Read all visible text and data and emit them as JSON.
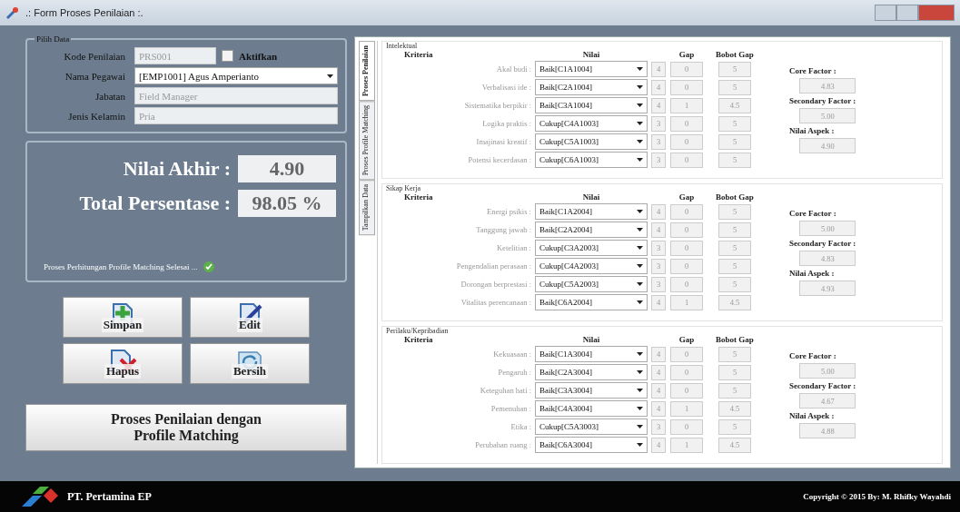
{
  "window": {
    "title": ".: Form Proses Penilaian :."
  },
  "pilih_data": {
    "legend": "Pilih Data",
    "kode_label": "Kode Penilaian",
    "kode_value": "PRS001",
    "aktifkan": {
      "label": "Aktifkan",
      "checked": false
    },
    "nama_label": "Nama Pegawai",
    "nama_value": "[EMP1001] Agus Amperianto",
    "jabatan_label": "Jabatan",
    "jabatan_value": "Field Manager",
    "jk_label": "Jenis Kelamin",
    "jk_value": "Pria"
  },
  "hasil": {
    "nilai_label": "Nilai Akhir :",
    "nilai_value": "4.90",
    "persen_label": "Total Persentase :",
    "persen_value": "98.05 %",
    "status": "Proses Perhitungan Profile Matching Selesai ..."
  },
  "buttons": [
    {
      "kind": "save",
      "label": "Simpan"
    },
    {
      "kind": "edit",
      "label": "Edit"
    },
    {
      "kind": "delete",
      "label": "Hapus"
    },
    {
      "kind": "clear",
      "label": "Bersih"
    }
  ],
  "proses_button": "Proses Penilaian dengan Profile Matching",
  "tabs": [
    {
      "label": "Proses Penilaian",
      "selected": true
    },
    {
      "label": "Proses Profile Matching",
      "selected": false
    },
    {
      "label": "Tampilkan Data",
      "selected": false
    }
  ],
  "aspects": [
    {
      "title": "Intelektual",
      "columns": {
        "kriteria": "Kriteria",
        "nilai": "Nilai",
        "gap": "Gap",
        "bobot": "Bobot Gap"
      },
      "core_label": "Core Factor :",
      "core": "4.83",
      "secondary_label": "Secondary Factor :",
      "secondary": "5.00",
      "aspek_label": "Nilai Aspek :",
      "aspek": "4.90",
      "rows": [
        {
          "label": "Akal budi :",
          "value": "Baik[C1A1004]",
          "nilai": "4",
          "gap": "0",
          "bobot": "5"
        },
        {
          "label": "Verbalisasi ide :",
          "value": "Baik[C2A1004]",
          "nilai": "4",
          "gap": "0",
          "bobot": "5"
        },
        {
          "label": "Sistematika berpikir :",
          "value": "Baik[C3A1004]",
          "nilai": "4",
          "gap": "1",
          "bobot": "4.5"
        },
        {
          "label": "Logika praktis :",
          "value": "Cukup[C4A1003]",
          "nilai": "3",
          "gap": "0",
          "bobot": "5"
        },
        {
          "label": "Imajinasi kreatif :",
          "value": "Cukup[C5A1003]",
          "nilai": "3",
          "gap": "0",
          "bobot": "5"
        },
        {
          "label": "Potensi kecerdasan :",
          "value": "Cukup[C6A1003]",
          "nilai": "3",
          "gap": "0",
          "bobot": "5"
        }
      ]
    },
    {
      "title": "Sikap Kerja",
      "columns": {
        "kriteria": "Kriteria",
        "nilai": "Nilai",
        "gap": "Gap",
        "bobot": "Bobot Gap"
      },
      "core_label": "Core Factor :",
      "core": "5.00",
      "secondary_label": "Secondary Factor :",
      "secondary": "4.83",
      "aspek_label": "Nilai Aspek :",
      "aspek": "4.93",
      "rows": [
        {
          "label": "Energi psikis :",
          "value": "Baik[C1A2004]",
          "nilai": "4",
          "gap": "0",
          "bobot": "5"
        },
        {
          "label": "Tanggung jawab :",
          "value": "Baik[C2A2004]",
          "nilai": "4",
          "gap": "0",
          "bobot": "5"
        },
        {
          "label": "Ketelitian :",
          "value": "Cukup[C3A2003]",
          "nilai": "3",
          "gap": "0",
          "bobot": "5"
        },
        {
          "label": "Pengendalian perasaan :",
          "value": "Cukup[C4A2003]",
          "nilai": "3",
          "gap": "0",
          "bobot": "5"
        },
        {
          "label": "Dorongan berprestasi :",
          "value": "Cukup[C5A2003]",
          "nilai": "3",
          "gap": "0",
          "bobot": "5"
        },
        {
          "label": "Vitalitas perencanaan :",
          "value": "Baik[C6A2004]",
          "nilai": "4",
          "gap": "1",
          "bobot": "4.5"
        }
      ]
    },
    {
      "title": "Perilaku/Kepribadian",
      "columns": {
        "kriteria": "Kriteria",
        "nilai": "Nilai",
        "gap": "Gap",
        "bobot": "Bobot Gap"
      },
      "core_label": "Core Factor :",
      "core": "5.00",
      "secondary_label": "Secondary Factor :",
      "secondary": "4.67",
      "aspek_label": "Nilai Aspek :",
      "aspek": "4.88",
      "rows": [
        {
          "label": "Kekuasaan :",
          "value": "Baik[C1A3004]",
          "nilai": "4",
          "gap": "0",
          "bobot": "5"
        },
        {
          "label": "Pengaruh :",
          "value": "Baik[C2A3004]",
          "nilai": "4",
          "gap": "0",
          "bobot": "5"
        },
        {
          "label": "Keteguhan hati :",
          "value": "Baik[C3A3004]",
          "nilai": "4",
          "gap": "0",
          "bobot": "5"
        },
        {
          "label": "Pemenuhan :",
          "value": "Baik[C4A3004]",
          "nilai": "4",
          "gap": "1",
          "bobot": "4.5"
        },
        {
          "label": "Etika :",
          "value": "Cukup[C5A3003]",
          "nilai": "3",
          "gap": "0",
          "bobot": "5"
        },
        {
          "label": "Perubahan ruang :",
          "value": "Baik[C6A3004]",
          "nilai": "4",
          "gap": "1",
          "bobot": "4.5"
        }
      ]
    }
  ],
  "footer": {
    "company": "PT. Pertamina EP",
    "copyright": "Copyright © 2015 By: M. Rhifky Wayahdi"
  }
}
